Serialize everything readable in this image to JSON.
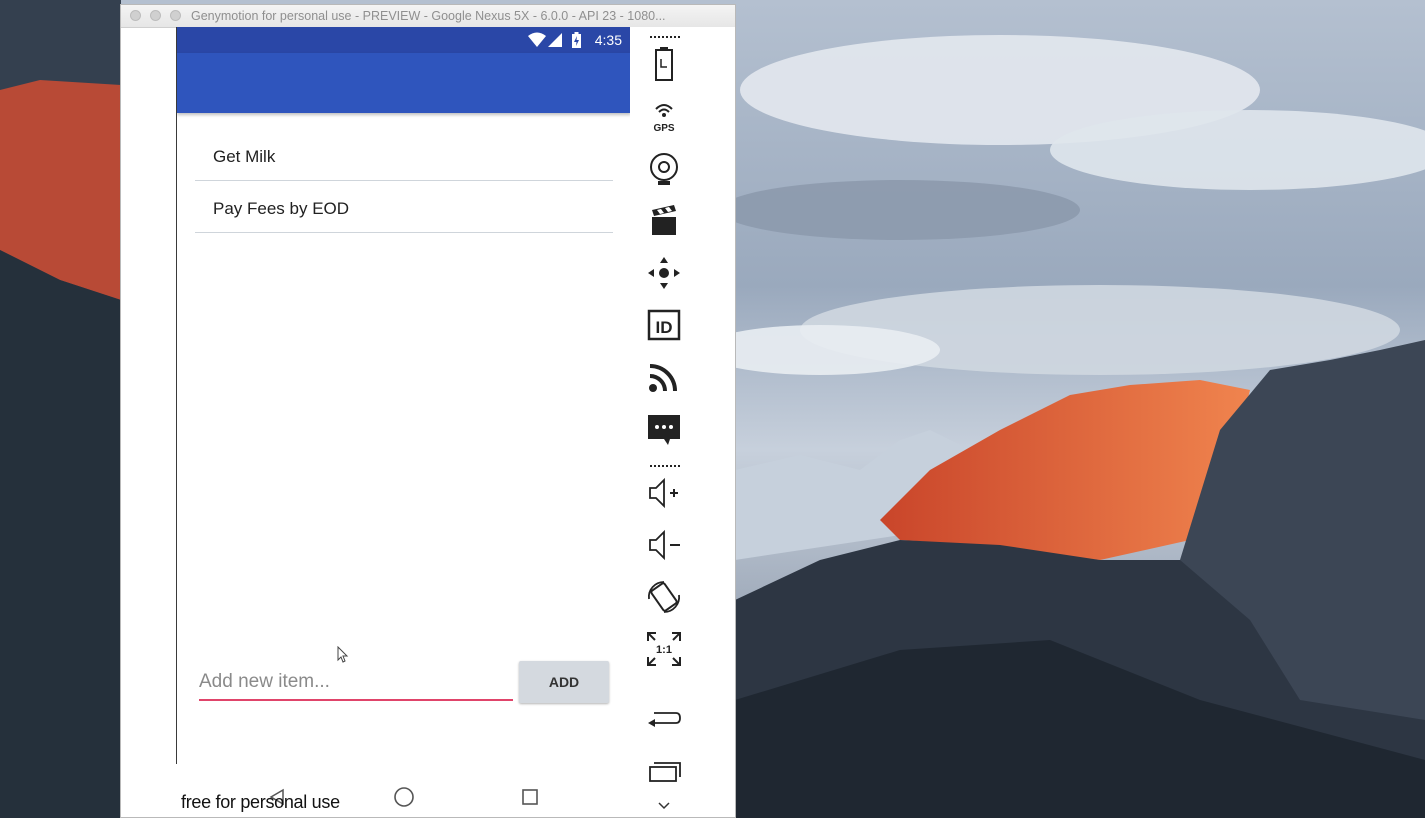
{
  "window": {
    "title": "Genymotion for personal use - PREVIEW - Google Nexus 5X - 6.0.0 - API 23 - 1080..."
  },
  "status_bar": {
    "time": "4:35"
  },
  "todo": {
    "items": [
      "Get Milk",
      "Pay Fees by EOD"
    ],
    "input_placeholder": "Add new item...",
    "add_label": "ADD"
  },
  "footer": {
    "watermark": "free for personal use"
  },
  "toolbar": {
    "icons": [
      "battery-icon",
      "gps-icon",
      "webcam-icon",
      "capture-icon",
      "dpad-icon",
      "device-id-icon",
      "network-icon",
      "sms-icon",
      "volume-up-icon",
      "volume-down-icon",
      "rotate-icon",
      "pixel-perfect-icon",
      "back-icon",
      "recent-apps-icon",
      "chevron-down-icon"
    ]
  },
  "colors": {
    "status_bar": "#2a47a7",
    "app_bar": "#2f55bd",
    "input_underline": "#e0446a",
    "add_button": "#d4d9df"
  }
}
